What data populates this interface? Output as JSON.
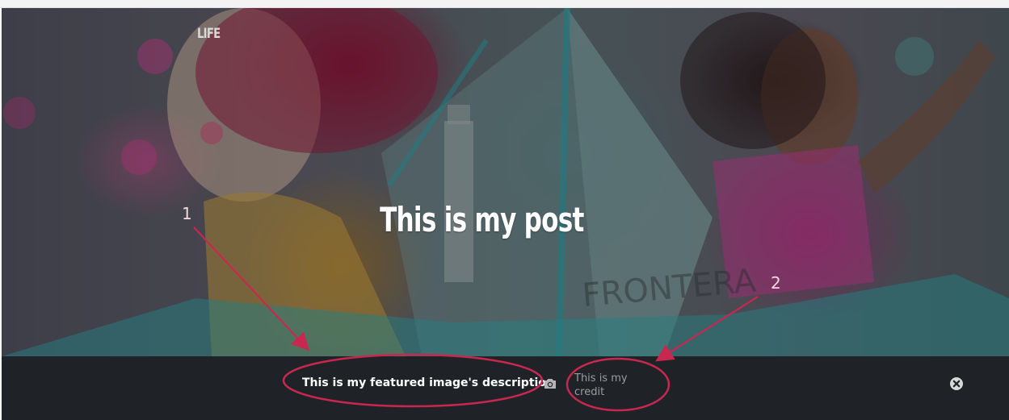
{
  "post": {
    "category": "LIFE",
    "title": "This is my post"
  },
  "featured_image": {
    "description": "This is my featured image's description",
    "credit": "This is my credit"
  },
  "icons": {
    "camera": "camera-icon",
    "close": "close-circle-icon"
  },
  "annotations": {
    "marker_1": "1",
    "marker_2": "2",
    "color": "#c8284f"
  }
}
